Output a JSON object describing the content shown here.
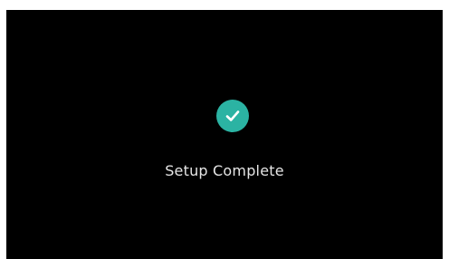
{
  "screen": {
    "status_icon": "check-circle-icon",
    "status_text": "Setup Complete",
    "colors": {
      "background": "#000000",
      "accent": "#2bb3a3",
      "text": "#e6e6e6",
      "frame": "#ffffff"
    }
  }
}
